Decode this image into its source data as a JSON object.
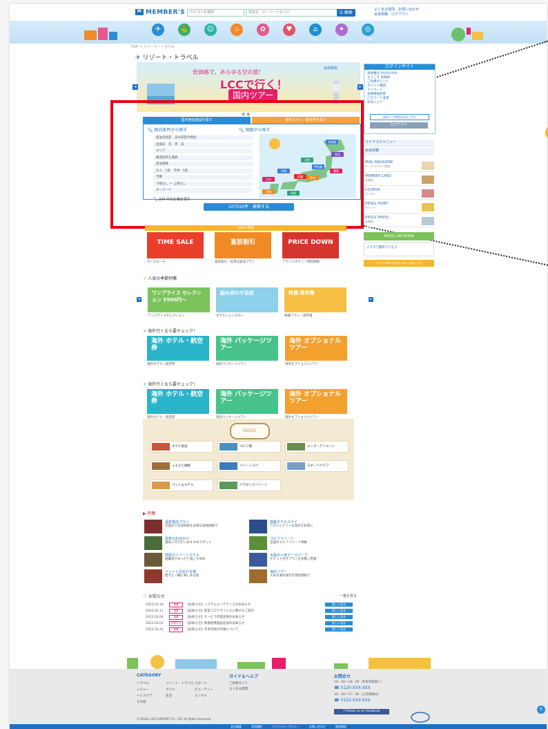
{
  "header": {
    "logo_mark": "M",
    "logo": "MEMBER'S NAVI",
    "category_select": "カテゴリを選択",
    "search_placeholder": "施設名・キーワードを入力",
    "search_button": "Q 検索",
    "links": [
      "よくある質問",
      "お問い合わせ"
    ],
    "links2": [
      "会員情報",
      "ログアウト"
    ]
  },
  "categories": [
    {
      "icon": "✈",
      "label": "トラベル",
      "color": "#2a8dd4"
    },
    {
      "icon": "⛳",
      "label": "スポーツ",
      "color": "#3bb06a"
    },
    {
      "icon": "☺",
      "label": "レジャー",
      "color": "#2fb3a0"
    },
    {
      "icon": "♨",
      "label": "グルメ",
      "color": "#f08a24"
    },
    {
      "icon": "✿",
      "label": "ビューティー",
      "color": "#e45a8c"
    },
    {
      "icon": "♥",
      "label": "ヘルスケア",
      "color": "#e05565"
    },
    {
      "icon": "⌂",
      "label": "生活",
      "color": "#1f8fcf"
    },
    {
      "icon": "✦",
      "label": "エンタメ",
      "color": "#b06bd1"
    },
    {
      "icon": "◎",
      "label": "その他",
      "color": "#2f9fd0"
    }
  ],
  "breadcrumb": "TOP ＞ リゾート・トラベル",
  "page_title": "リゾート・トラベル",
  "banner": {
    "line1": "低価格で、あらゆる空の旅！",
    "line2": "LCCで行く！",
    "line3": "国内ツアー",
    "corner": "会員限定"
  },
  "search": {
    "tab1": "国内宿泊施設を探す",
    "tab2": "海外ホテル・航空券を探す",
    "left_heading": "宿泊条件から探す",
    "right_heading": "地図から探す",
    "rows": [
      "宿泊日指定　日付未定の場合",
      "出発日　年　月　日",
      "エリア",
      "都道府県を選択",
      "宿泊者数",
      "大人　1名　子供　0名",
      "予算",
      "下限なし 〜 上限なし",
      "キーワード"
    ],
    "count_text": "224 件のお宿を探す",
    "search_button": "107550件　検索する",
    "prefs": [
      {
        "name": "北海道",
        "color": "#3d7fd6"
      },
      {
        "name": "東北",
        "color": "#7a4cc2"
      },
      {
        "name": "甲信越",
        "color": "#3d7fd6"
      },
      {
        "name": "関東",
        "color": "#e4206a"
      },
      {
        "name": "北陸",
        "color": "#2fa07a"
      },
      {
        "name": "東海",
        "color": "#f08a24"
      },
      {
        "name": "近畿",
        "color": "#d6342f"
      },
      {
        "name": "中国",
        "color": "#3d7fd6"
      },
      {
        "name": "四国",
        "color": "#2fa07a"
      },
      {
        "name": "九州",
        "color": "#e4206a"
      },
      {
        "name": "沖縄",
        "color": "#f08a24"
      }
    ]
  },
  "sale": {
    "heading": "SALE 情報",
    "items": [
      {
        "text": "TIME SALE",
        "caption": "タイムセール",
        "color": "#e83e2a"
      },
      {
        "text": "直前割引",
        "caption": "直前割引・お得な宿泊プラン",
        "color": "#f08a24"
      },
      {
        "text": "PRICE DOWN",
        "caption": "プライスダウン・特別価格",
        "color": "#d6342f"
      }
    ]
  },
  "special": {
    "heading": "人気の季節特集",
    "items": [
      {
        "text": "ワンプライス セレクション 5500円〜",
        "color": "#7cc35a",
        "caption": "ワンプライスセレクション"
      },
      {
        "text": "組み合わせ自由",
        "color": "#8dd0ea",
        "caption": "ホテル＋レンタカー"
      },
      {
        "text": "特選 得市場",
        "color": "#f5c043",
        "caption": "特選プラン・得市場"
      }
    ]
  },
  "overseas1": {
    "heading": "海外行くなら要チェック！",
    "items": [
      {
        "text": "海外 ホテル・航空券",
        "caption": "海外ホテル・航空券",
        "color": "#29b4c9"
      },
      {
        "text": "海外 パッケージツアー",
        "caption": "海外パッケージツアー",
        "color": "#47c28a"
      },
      {
        "text": "海外 オプショナルツアー",
        "caption": "海外オプショナルツアー",
        "color": "#f3a12e"
      }
    ]
  },
  "overseas2": {
    "heading": "海外行くなら要チェック！",
    "items": [
      {
        "text": "海外 ホテル・航空券",
        "caption": "海外ホテル・航空券",
        "color": "#29b4c9"
      },
      {
        "text": "海外 パッケージツアー",
        "caption": "海外パッケージツアー",
        "color": "#47c28a"
      },
      {
        "text": "海外 オプショナルツアー",
        "caption": "海外オプショナルツアー",
        "color": "#f3a12e"
      }
    ]
  },
  "resol": {
    "logo": "RESOL",
    "items": [
      "ホテル宿泊",
      "ゴルフ場",
      "エンターテイメント",
      "ふるさと納税",
      "リゾートスパ",
      "スポーツクラブ",
      "ペット＆ホテル",
      "パラダイスリゾート"
    ]
  },
  "features": {
    "heading": "特集",
    "items": [
      {
        "title": "温泉宿泊プラン",
        "desc": "全国の人気温泉宿をお得な会員価格で",
        "color": "#7a2e2e"
      },
      {
        "title": "高級ホテルステイ",
        "desc": "ラグジュアリーな滞在をお得に",
        "color": "#2a4f8c"
      },
      {
        "title": "週末のお出かけ",
        "desc": "週末に行きたいおすすめスポット",
        "color": "#4b6b3a"
      },
      {
        "title": "ゴルフリゾート",
        "desc": "全国のゴルフリゾート特集",
        "color": "#5a8f3a"
      },
      {
        "title": "高原のリゾートホテル",
        "desc": "避暑地でゆったり過ごす休日",
        "color": "#6b5a3a"
      },
      {
        "title": "大阪の人気テーマパーク",
        "desc": "チケット付きプランを多数ご用意",
        "color": "#3a5a9c"
      },
      {
        "title": "ペットと泊まれる宿",
        "desc": "愛犬と一緒に楽しめる宿",
        "color": "#8c3a2e"
      },
      {
        "title": "海外ツアー",
        "desc": "人気の海外旅行を特別価格で",
        "color": "#a06b2e"
      }
    ]
  },
  "news": {
    "heading": "お知らせ",
    "more": "一覧を見る",
    "items": [
      {
        "date": "2022.03.18",
        "tag": "重要",
        "text": "【お知らせ】システムメンテナンスのお知らせ",
        "btn": "詳しく見る"
      },
      {
        "date": "2022.03.11",
        "tag": "重要",
        "text": "【お知らせ】新型コロナウイルスに関するご案内",
        "btn": "詳しく見る"
      },
      {
        "date": "2022.03.04",
        "tag": "重要",
        "text": "【お知らせ】サービス内容変更のお知らせ",
        "btn": "詳しく見る"
      },
      {
        "date": "2022.03.01",
        "tag": "お知らせ",
        "text": "【お知らせ】新規提携施設追加のお知らせ",
        "btn": "詳しく見る"
      },
      {
        "date": "2022.02.24",
        "tag": "重要",
        "text": "【お知らせ】年末年始の営業について",
        "btn": "詳しく見る"
      }
    ]
  },
  "sidebar": {
    "login_title": "ログインサイト",
    "login_lines": [
      "会員番号 XXXXXXXX",
      "ようこそ 会員様",
      "ご利用ポイント",
      "ポイント確認",
      "マイページ",
      "会員情報変更",
      "パスワード変更",
      "お気に入り"
    ],
    "login_note": "初めてご利用の方はこちら",
    "logout": "ログアウト",
    "menu1": "マイデスクメニュー",
    "menu2": "会員情報",
    "rows": [
      {
        "title": "MAIL MAGAZINE",
        "sub": "メールマガジン登録"
      },
      {
        "title": "MEMBER CARD",
        "sub": "会員証"
      },
      {
        "title": "COUPON",
        "sub": "クーポン"
      },
      {
        "title": "RESOL POINT",
        "sub": "ポイント"
      },
      {
        "title": "RESOL PRESS",
        "sub": "会報誌"
      }
    ],
    "vacation": "RESOL VACATION",
    "app": "スマホで簡単アクセス",
    "apply": "ログインIDをお持ちでない方はこちら"
  },
  "footer": {
    "category_title": "CATEGORY",
    "categories": [
      "トラベル",
      "リゾート・トラベル",
      "スポーツ",
      "レジャー",
      "グルメ",
      "ビューティー",
      "ヘルスケア",
      "生活",
      "エンタメ",
      "その他"
    ],
    "guide_title": "ガイド＆ヘルプ",
    "guide": [
      "ご利用ガイド",
      "よくある質問"
    ],
    "contact_title": "お問合せ",
    "contact_lines": [
      "10：00〜18：00（年末年始除く）",
      "0120-XXX-XXX",
      "10：00〜17：00（土日祝休み）",
      "0120-XXX-XXX"
    ],
    "facebook": "Follow us on facebook",
    "bottom_links": [
      "会社概要",
      "利用規約",
      "プライバシーポリシー",
      "お問い合わせ",
      "推奨環境"
    ],
    "copyright": "© RESOL LIFE SUPPORT CO., LTD. All Rights Reserved."
  }
}
